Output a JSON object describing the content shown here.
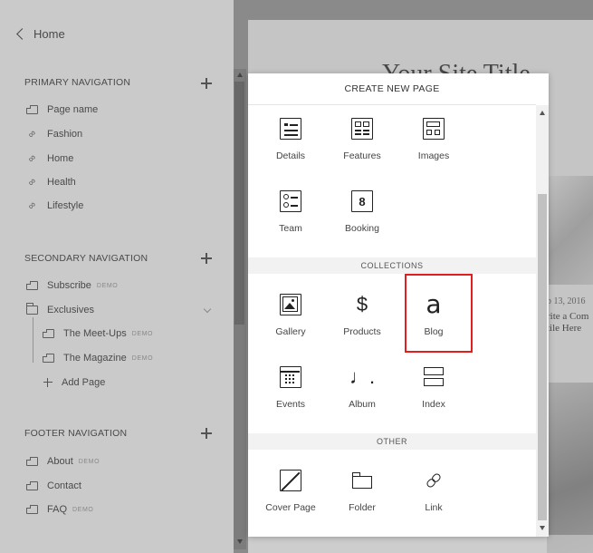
{
  "sidebar": {
    "home_label": "Home",
    "primary": {
      "title": "PRIMARY NAVIGATION",
      "items": [
        {
          "label": "Page name",
          "icon": "page-icon"
        },
        {
          "label": "Fashion",
          "icon": "link-icon"
        },
        {
          "label": "Home",
          "icon": "link-icon"
        },
        {
          "label": "Health",
          "icon": "link-icon"
        },
        {
          "label": "Lifestyle",
          "icon": "link-icon"
        }
      ]
    },
    "secondary": {
      "title": "SECONDARY NAVIGATION",
      "items": [
        {
          "label": "Subscribe",
          "badge": "DEMO"
        },
        {
          "label": "Exclusives"
        },
        {
          "label": "The Meet-Ups",
          "badge": "DEMO"
        },
        {
          "label": "The Magazine",
          "badge": "DEMO"
        },
        {
          "label": "Add Page"
        }
      ]
    },
    "footer": {
      "title": "FOOTER NAVIGATION",
      "items": [
        {
          "label": "About",
          "badge": "DEMO"
        },
        {
          "label": "Contact"
        },
        {
          "label": "FAQ",
          "badge": "DEMO"
        }
      ]
    }
  },
  "preview": {
    "site_title": "Your Site Title",
    "post_date": "p 13, 2016",
    "post_title_1": "rite a Com",
    "post_title_2": "tile Here"
  },
  "modal": {
    "title": "CREATE NEW PAGE",
    "pages": [
      {
        "label": "Details"
      },
      {
        "label": "Features"
      },
      {
        "label": "Images"
      },
      {
        "label": "Team"
      },
      {
        "label": "Booking"
      }
    ],
    "collections_title": "COLLECTIONS",
    "collections": [
      {
        "label": "Gallery"
      },
      {
        "label": "Products"
      },
      {
        "label": "Blog"
      },
      {
        "label": "Events"
      },
      {
        "label": "Album"
      },
      {
        "label": "Index"
      }
    ],
    "other_title": "OTHER",
    "other": [
      {
        "label": "Cover Page"
      },
      {
        "label": "Folder"
      },
      {
        "label": "Link"
      }
    ],
    "booking_glyph": "8",
    "products_glyph": "$",
    "blog_glyph": "a",
    "album_glyph": "♩."
  },
  "colors": {
    "highlight": "#e02020",
    "overlay": "#8a8a8a"
  }
}
